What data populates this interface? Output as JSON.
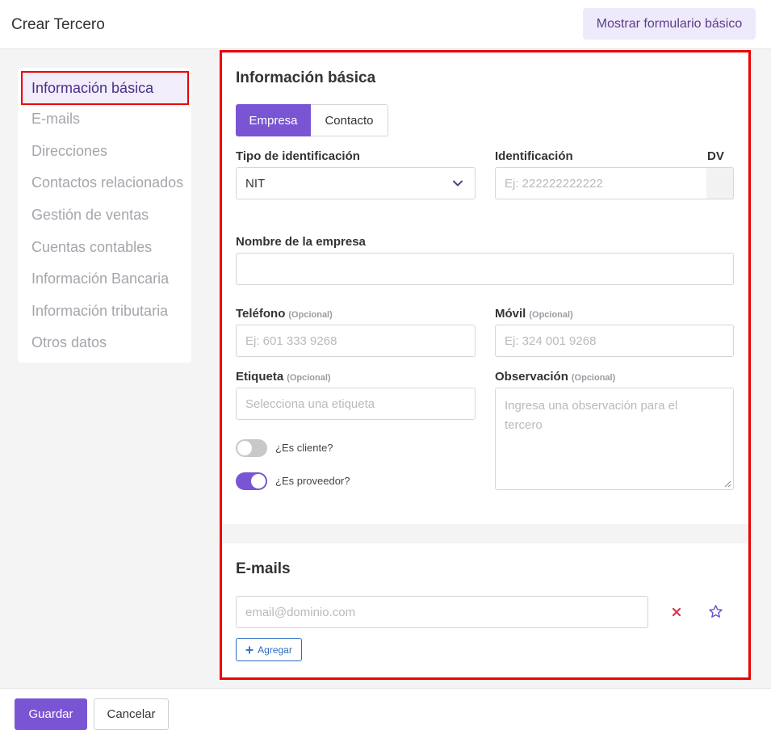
{
  "header": {
    "title": "Crear Tercero",
    "toggle_form_label": "Mostrar formulario básico"
  },
  "sidenav": {
    "items": [
      {
        "label": "Información básica",
        "active": true
      },
      {
        "label": "E-mails"
      },
      {
        "label": "Direcciones"
      },
      {
        "label": "Contactos relacionados"
      },
      {
        "label": "Gestión de ventas"
      },
      {
        "label": "Cuentas contables"
      },
      {
        "label": "Información Bancaria"
      },
      {
        "label": "Información tributaria"
      },
      {
        "label": "Otros datos"
      }
    ]
  },
  "basic": {
    "title": "Información básica",
    "segment": {
      "company": "Empresa",
      "contact": "Contacto",
      "selected": "Empresa"
    },
    "id_type": {
      "label": "Tipo de identificación",
      "value": "NIT"
    },
    "identification": {
      "label": "Identificación",
      "placeholder": "Ej: 222222222222"
    },
    "dv": {
      "label": "DV"
    },
    "company_name": {
      "label": "Nombre de la empresa"
    },
    "phone": {
      "label": "Teléfono",
      "optional": "(Opcional)",
      "placeholder": "Ej: 601 333 9268"
    },
    "mobile": {
      "label": "Móvil",
      "optional": "(Opcional)",
      "placeholder": "Ej: 324 001 9268"
    },
    "tag": {
      "label": "Etiqueta",
      "optional": "(Opcional)",
      "placeholder": "Selecciona una etiqueta"
    },
    "observation": {
      "label": "Observación",
      "optional": "(Opcional)",
      "placeholder": "Ingresa una observación para el tercero"
    },
    "is_client": {
      "label": "¿Es cliente?",
      "on": false
    },
    "is_supplier": {
      "label": "¿Es proveedor?",
      "on": true
    }
  },
  "emails": {
    "title": "E-mails",
    "placeholder": "email@dominio.com",
    "add_label": "Agregar"
  },
  "footer": {
    "save_label": "Guardar",
    "cancel_label": "Cancelar"
  },
  "colors": {
    "accent": "#7a55d3",
    "highlight_border": "#ee0000",
    "delete": "#e0334f",
    "link": "#2a6cc0"
  }
}
